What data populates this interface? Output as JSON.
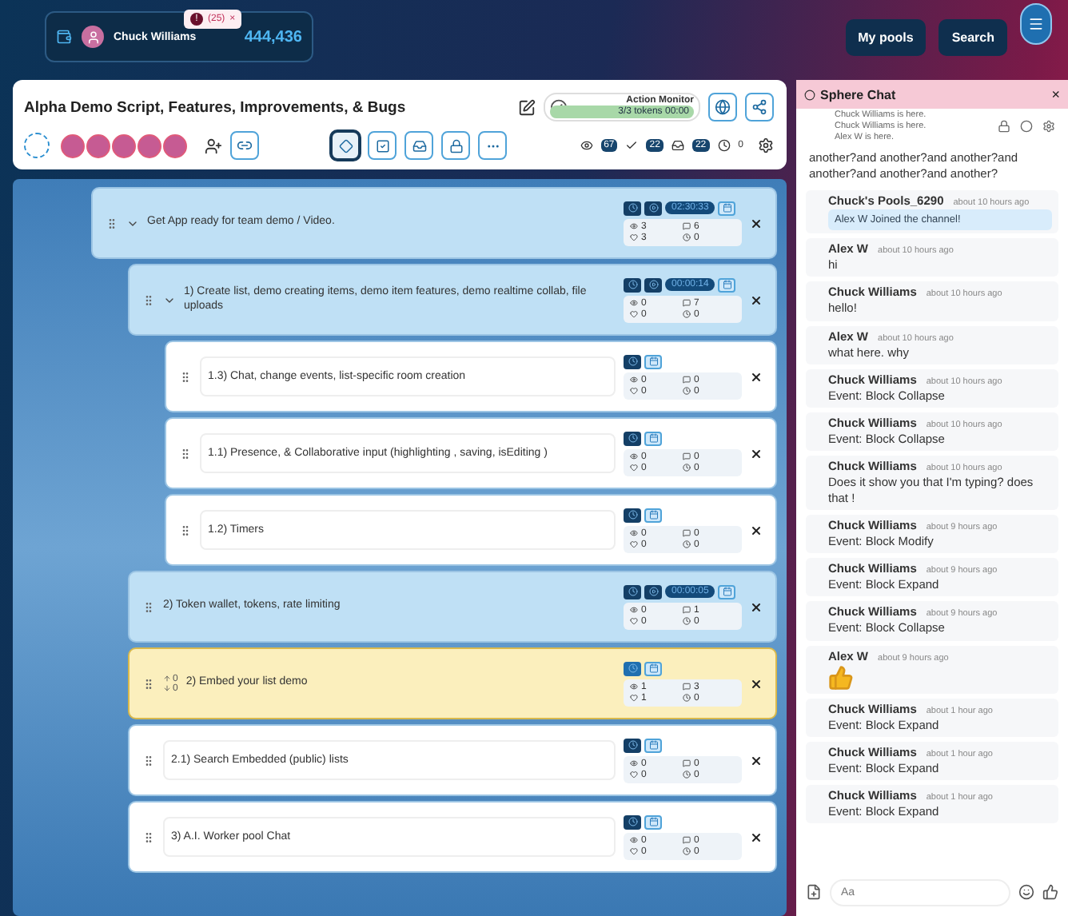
{
  "topbar": {
    "user": "Chuck Williams",
    "alert_badge": {
      "icon": "!",
      "count": "(25)",
      "close": "×"
    },
    "balance": "444,436",
    "buttons": [
      "My pools",
      "Search"
    ]
  },
  "list_header": {
    "title": "Alpha Demo Script, Features, Improvements, & Bugs",
    "action_monitor": {
      "label": "Action Monitor",
      "tokens": "3/3 tokens 00:00",
      "level": 1
    },
    "view_buttons": [
      {
        "selected": true
      },
      {
        "selected": false
      },
      {
        "selected": false
      },
      {
        "selected": false
      },
      {
        "selected": false
      }
    ],
    "counts": {
      "views": "67",
      "done": "22",
      "inbox": "22",
      "time": "0"
    }
  },
  "items": [
    {
      "kind": "group",
      "title": "Get App ready for team demo / Video.",
      "expanded": true,
      "timer": "02:30:33",
      "views": "3",
      "comments": "6",
      "likes": "3",
      "time": "0",
      "children": [
        {
          "kind": "group",
          "title": "1) Create list, demo creating items, demo item features, demo realtime collab, file uploads",
          "expanded": true,
          "timer": "00:00:14",
          "views": "0",
          "comments": "7",
          "likes": "0",
          "time": "0",
          "children": [
            {
              "kind": "task",
              "title": "1.3) Chat, change events, list-specific room creation",
              "views": "0",
              "comments": "0",
              "likes": "0",
              "time": "0"
            },
            {
              "kind": "task",
              "title": "1.1) Presence, & Collaborative input (highlighting , saving, isEditing )",
              "views": "0",
              "comments": "0",
              "likes": "0",
              "time": "0"
            },
            {
              "kind": "task",
              "title": "1.2) Timers",
              "views": "0",
              "comments": "0",
              "likes": "0",
              "time": "0"
            }
          ]
        },
        {
          "kind": "group",
          "title": "2) Token wallet, tokens, rate limiting",
          "timer": "00:00:05",
          "views": "0",
          "comments": "1",
          "likes": "0",
          "time": "0"
        },
        {
          "kind": "highlight",
          "title": "2) Embed your list demo",
          "up": "0",
          "down": "0",
          "views": "1",
          "comments": "3",
          "likes": "1",
          "time": "0"
        },
        {
          "kind": "task",
          "title": "2.1) Search Embedded (public) lists",
          "views": "0",
          "comments": "0",
          "likes": "0",
          "time": "0"
        },
        {
          "kind": "task",
          "title": "3) A.I. Worker pool Chat",
          "views": "0",
          "comments": "0",
          "likes": "0",
          "time": "0"
        }
      ]
    }
  ],
  "chat": {
    "title": "Sphere Chat",
    "close": "×",
    "presence": [
      "Chuck Williams is here.",
      "Chuck Williams is here.",
      "Alex W is here."
    ],
    "messages": [
      {
        "kind": "text",
        "text": "another?and another?and another?and another?and another?and another?"
      },
      {
        "kind": "notice",
        "author": "Chuck's Pools_6290",
        "time": "about 10 hours ago",
        "text": "Alex W Joined the channel!"
      },
      {
        "kind": "text",
        "author": "Alex W",
        "time": "about 10 hours ago",
        "text": "hi"
      },
      {
        "kind": "text",
        "author": "Chuck Williams",
        "time": "about 10 hours ago",
        "text": "hello!"
      },
      {
        "kind": "text",
        "author": "Alex W",
        "time": "about 10 hours ago",
        "text": "what  here. why"
      },
      {
        "kind": "text",
        "author": "Chuck Williams",
        "time": "about 10 hours ago",
        "text": "Event: Block Collapse"
      },
      {
        "kind": "text",
        "author": "Chuck Williams",
        "time": "about 10 hours ago",
        "text": "Event: Block Collapse"
      },
      {
        "kind": "text",
        "author": "Chuck Williams",
        "time": "about 10 hours ago",
        "text": "Does it show you that I'm typing? does that !"
      },
      {
        "kind": "text",
        "author": "Chuck Williams",
        "time": "about 9 hours ago",
        "text": "Event: Block Modify"
      },
      {
        "kind": "text",
        "author": "Chuck Williams",
        "time": "about 9 hours ago",
        "text": "Event: Block Expand"
      },
      {
        "kind": "text",
        "author": "Chuck Williams",
        "time": "about 9 hours ago",
        "text": "Event: Block Collapse"
      },
      {
        "kind": "sticker",
        "author": "Alex W",
        "time": "about 9 hours ago"
      },
      {
        "kind": "text",
        "author": "Chuck Williams",
        "time": "about 1 hour ago",
        "text": "Event: Block Expand"
      },
      {
        "kind": "text",
        "author": "Chuck Williams",
        "time": "about 1 hour ago",
        "text": "Event: Block Expand"
      },
      {
        "kind": "text",
        "author": "Chuck Williams",
        "time": "about 1 hour ago",
        "text": "Event: Block Expand"
      }
    ],
    "input": {
      "placeholder": "Aa"
    }
  }
}
